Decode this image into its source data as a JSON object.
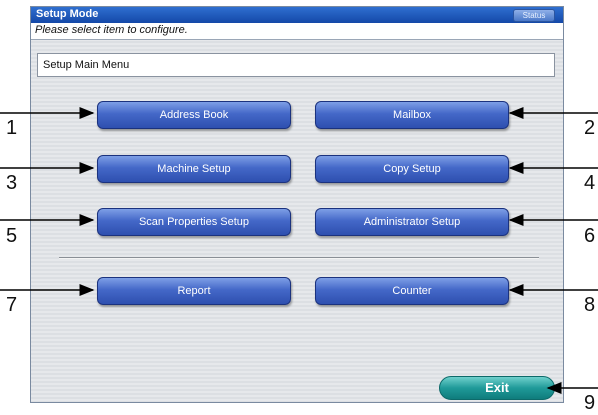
{
  "title": "Setup Mode",
  "status_label": "Status",
  "prompt": "Please select item to configure.",
  "menu_label": "Setup Main Menu",
  "buttons": {
    "address_book": "Address Book",
    "mailbox": "Mailbox",
    "machine_setup": "Machine Setup",
    "copy_setup": "Copy Setup",
    "scan_properties_setup": "Scan Properties Setup",
    "administrator_setup": "Administrator Setup",
    "report": "Report",
    "counter": "Counter",
    "exit": "Exit"
  },
  "callouts": [
    "1",
    "2",
    "3",
    "4",
    "5",
    "6",
    "7",
    "8",
    "9"
  ]
}
